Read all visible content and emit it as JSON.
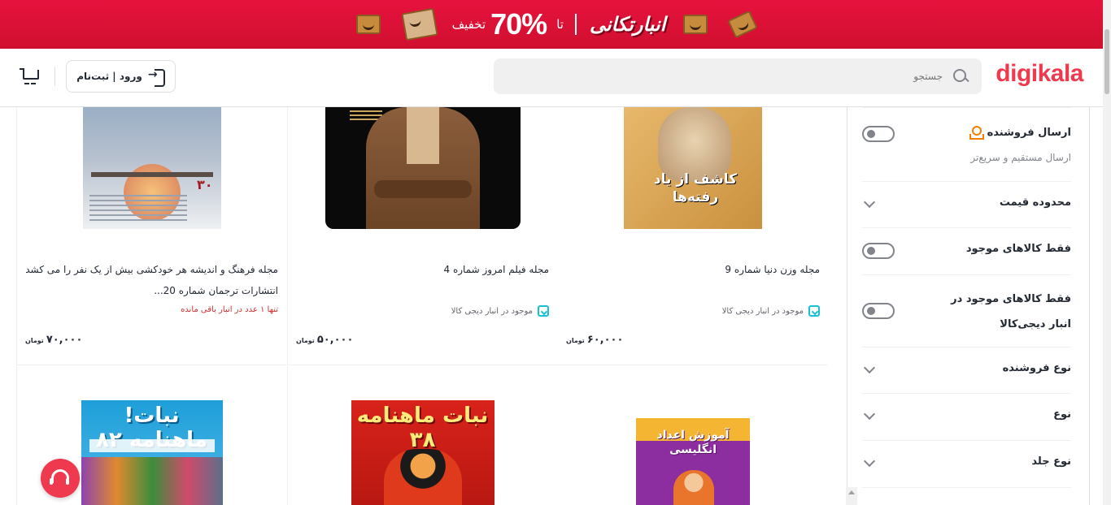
{
  "promo": {
    "discount_word": "تخفیف",
    "percent": "70%",
    "upto": "تا",
    "brand": "انبارتکانی"
  },
  "header": {
    "logo": "digikala",
    "search_placeholder": "جستجو",
    "login_label": "ورود | ثبت‌نام"
  },
  "products": [
    {
      "title": "مجله وزن دنیا شماره 9",
      "cover_text": "کاشف از یاد رفته‌ها",
      "stock": "موجود در انبار دیجی کالا",
      "price": "۶۰,۰۰۰",
      "currency": "تومان"
    },
    {
      "title": "مجله فیلم امروز شماره 4",
      "stock": "موجود در انبار دیجی کالا",
      "price": "۵۰,۰۰۰",
      "currency": "تومان"
    },
    {
      "title": "مجله فرهنگ و اندیشه هر خودکشی بیش از یک نفر را می کشد انتشارات ترجمان شماره 20...",
      "cover_text": "۳۰",
      "warning": "تنها ۱ عدد در انبار باقی مانده",
      "price": "۷۰,۰۰۰",
      "currency": "تومان"
    },
    {
      "cover_text": "آموزش اعداد انگلیسی"
    },
    {
      "cover_text": "نبات ماهنامه ۳۸"
    },
    {
      "cover_text": "نبات! ماهنامه ۸۲"
    }
  ],
  "filters": [
    {
      "label": "ارسال فروشنده",
      "sub": "ارسال مستقیم و سریع‌تر",
      "control": "toggle",
      "icon": "seller-icon",
      "on": false
    },
    {
      "label": "محدوده قیمت",
      "control": "chevron"
    },
    {
      "label": "فقط کالاهای موجود",
      "control": "toggle",
      "on": false
    },
    {
      "label": "فقط کالاهای موجود در انبار دیجی‌کالا",
      "control": "toggle",
      "on": false
    },
    {
      "label": "نوع فروشنده",
      "control": "chevron"
    },
    {
      "label": "نوع",
      "control": "chevron"
    },
    {
      "label": "نوع جلد",
      "control": "chevron"
    }
  ],
  "colors": {
    "brand": "#ef394e",
    "stock_icon": "#19bfd3",
    "warning": "#d32f2f"
  }
}
